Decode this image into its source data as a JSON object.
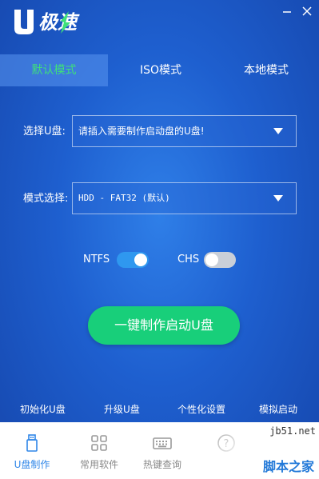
{
  "app": {
    "logo_text": "U极速"
  },
  "tabs": [
    {
      "label": "默认模式",
      "active": true
    },
    {
      "label": "ISO模式",
      "active": false
    },
    {
      "label": "本地模式",
      "active": false
    }
  ],
  "form": {
    "usb_label": "选择U盘:",
    "usb_value": "请插入需要制作启动盘的U盘!",
    "mode_label": "模式选择:",
    "mode_value": "HDD - FAT32 (默认)"
  },
  "options": {
    "ntfs_label": "NTFS",
    "ntfs_enabled": true,
    "chs_label": "CHS",
    "chs_enabled": false
  },
  "primary_button": "一键制作启动U盘",
  "quick_links": [
    "初始化U盘",
    "升级U盘",
    "个性化设置",
    "模拟启动"
  ],
  "bottom_nav": [
    {
      "label": "U盘制作",
      "icon": "usb-drive-icon",
      "active": true
    },
    {
      "label": "常用软件",
      "icon": "apps-grid-icon",
      "active": false
    },
    {
      "label": "热键查询",
      "icon": "keyboard-icon",
      "active": false
    },
    {
      "label": "",
      "icon": "help-icon",
      "active": false
    }
  ],
  "watermark": {
    "site": "jb51.net",
    "name": "脚本之家"
  },
  "colors": {
    "background": "#1e5fcf",
    "accent_green": "#18cf7a",
    "active_tab_text": "#3ee07a",
    "nav_active": "#2f86e8"
  }
}
